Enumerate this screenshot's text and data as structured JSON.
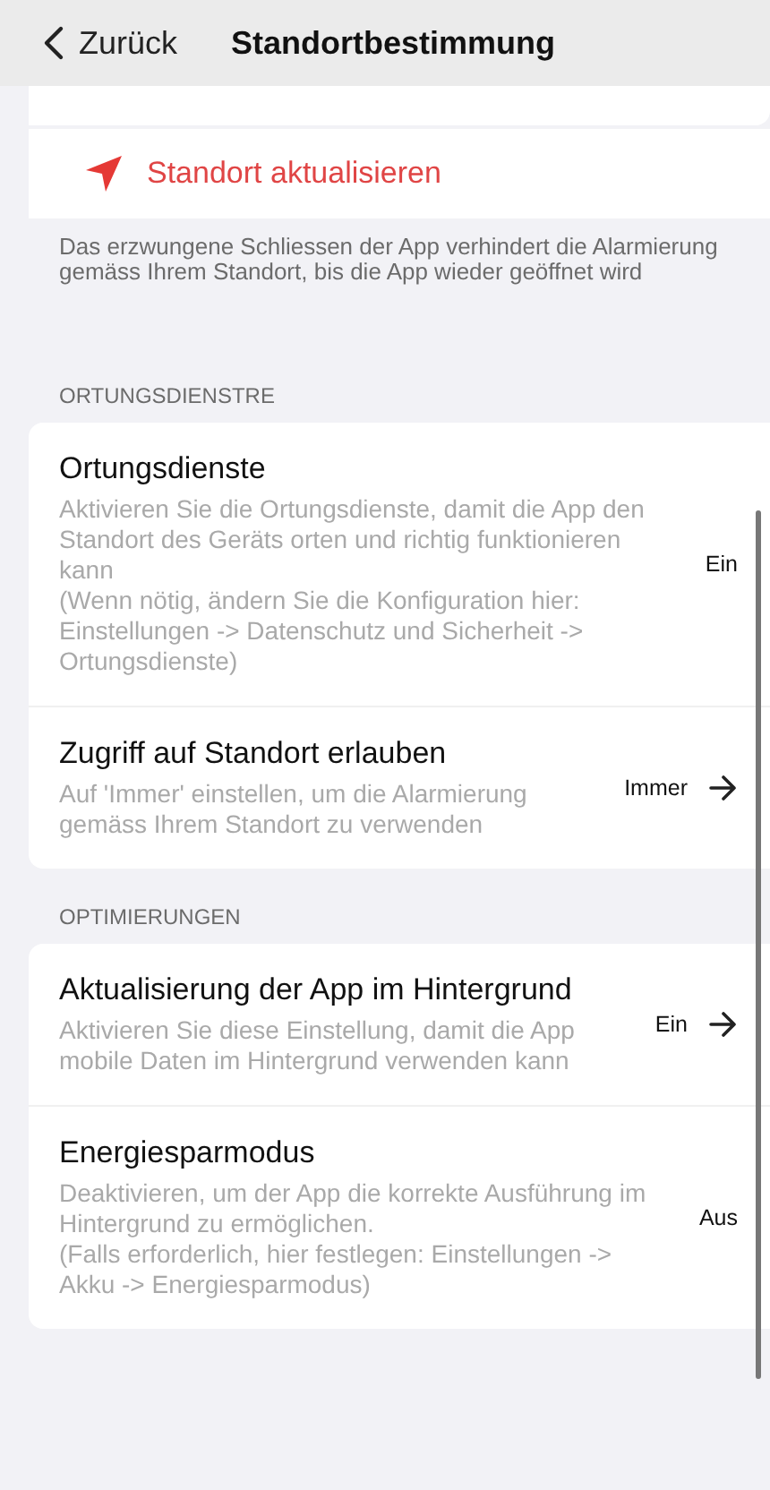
{
  "nav": {
    "back": "Zurück",
    "title": "Standortbestimmung"
  },
  "action": {
    "label": "Standort aktualisieren",
    "footer": "Das erzwungene Schliessen der App verhindert die Alarmierung gemäss Ihrem Standort, bis die App wieder geöffnet wird"
  },
  "sections": [
    {
      "header": "ORTUNGSDIENSTRE",
      "rows": [
        {
          "title": "Ortungsdienste",
          "description": "Aktivieren Sie die Ortungsdienste, damit die App den Standort des Geräts orten und richtig funktionieren kann\n(Wenn nötig, ändern Sie die Konfiguration hier: Einstellungen -> Datenschutz und Sicherheit -> Ortungsdienste)",
          "value": "Ein",
          "kind": "value"
        },
        {
          "title": "Zugriff auf Standort erlauben",
          "description": "Auf 'Immer' einstellen, um die Alarmierung gemäss Ihrem Standort zu verwenden",
          "value": "Immer",
          "kind": "link"
        }
      ]
    },
    {
      "header": "OPTIMIERUNGEN",
      "rows": [
        {
          "title": "Aktualisierung der App im Hintergrund",
          "description": "Aktivieren Sie diese Einstellung, damit die App mobile Daten im Hintergrund verwenden kann",
          "value": "Ein",
          "kind": "link"
        },
        {
          "title": "Energiesparmodus",
          "description": "Deaktivieren, um der App die korrekte Ausführung im Hintergrund zu ermöglichen.\n(Falls erforderlich, hier festlegen: Einstellungen -> Akku -> Energiesparmodus)",
          "value": "Aus",
          "kind": "value"
        }
      ]
    }
  ]
}
